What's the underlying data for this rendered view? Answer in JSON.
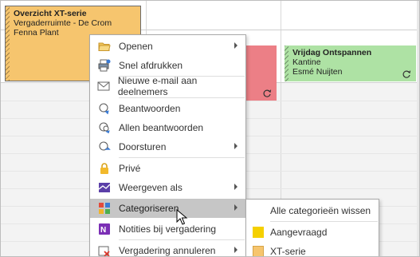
{
  "appointments": {
    "overzicht": {
      "title": "Overzicht XT-serie",
      "location": "Vergaderruimte - De Crom",
      "organizer": "Fenna Plant",
      "color": "#f6c56e"
    },
    "red_block": {
      "color": "#ec7f86"
    },
    "vrijdag": {
      "title": "Vrijdag Ontspannen",
      "location": "Kantine",
      "organizer": "Esmé Nuijten",
      "color": "#aee2a4"
    }
  },
  "context_menu": {
    "items": [
      {
        "label": "Openen",
        "icon": "folder-open-icon",
        "submenu": true
      },
      {
        "label": "Snel afdrukken",
        "icon": "quick-print-icon",
        "submenu": false
      },
      {
        "label": "Nieuwe e-mail aan deelnemers",
        "icon": "new-email-icon",
        "submenu": false
      },
      {
        "label": "Beantwoorden",
        "icon": "reply-icon",
        "submenu": false
      },
      {
        "label": "Allen beantwoorden",
        "icon": "reply-all-icon",
        "submenu": false
      },
      {
        "label": "Doorsturen",
        "icon": "forward-icon",
        "submenu": true
      },
      {
        "label": "Privé",
        "icon": "lock-icon",
        "submenu": false
      },
      {
        "label": "Weergeven als",
        "icon": "show-as-icon",
        "submenu": true
      },
      {
        "label": "Categoriseren",
        "icon": "categorize-icon",
        "submenu": true,
        "highlighted": true
      },
      {
        "label": "Notities bij vergadering",
        "icon": "onenote-icon",
        "submenu": false
      },
      {
        "label": "Vergadering annuleren",
        "icon": "cancel-meeting-icon",
        "submenu": true
      }
    ]
  },
  "categorize_submenu": {
    "items": [
      {
        "label": "Alle categorieën wissen",
        "icon": "",
        "color": ""
      },
      {
        "label": "Aangevraagd",
        "icon": "category-color-icon",
        "color": "#f5d000"
      },
      {
        "label": "XT-serie",
        "icon": "category-color-icon",
        "color": "#f6c56e"
      }
    ]
  },
  "colors": {
    "highlight": "#c6c6c6",
    "menu_border": "#a9a9a9"
  }
}
